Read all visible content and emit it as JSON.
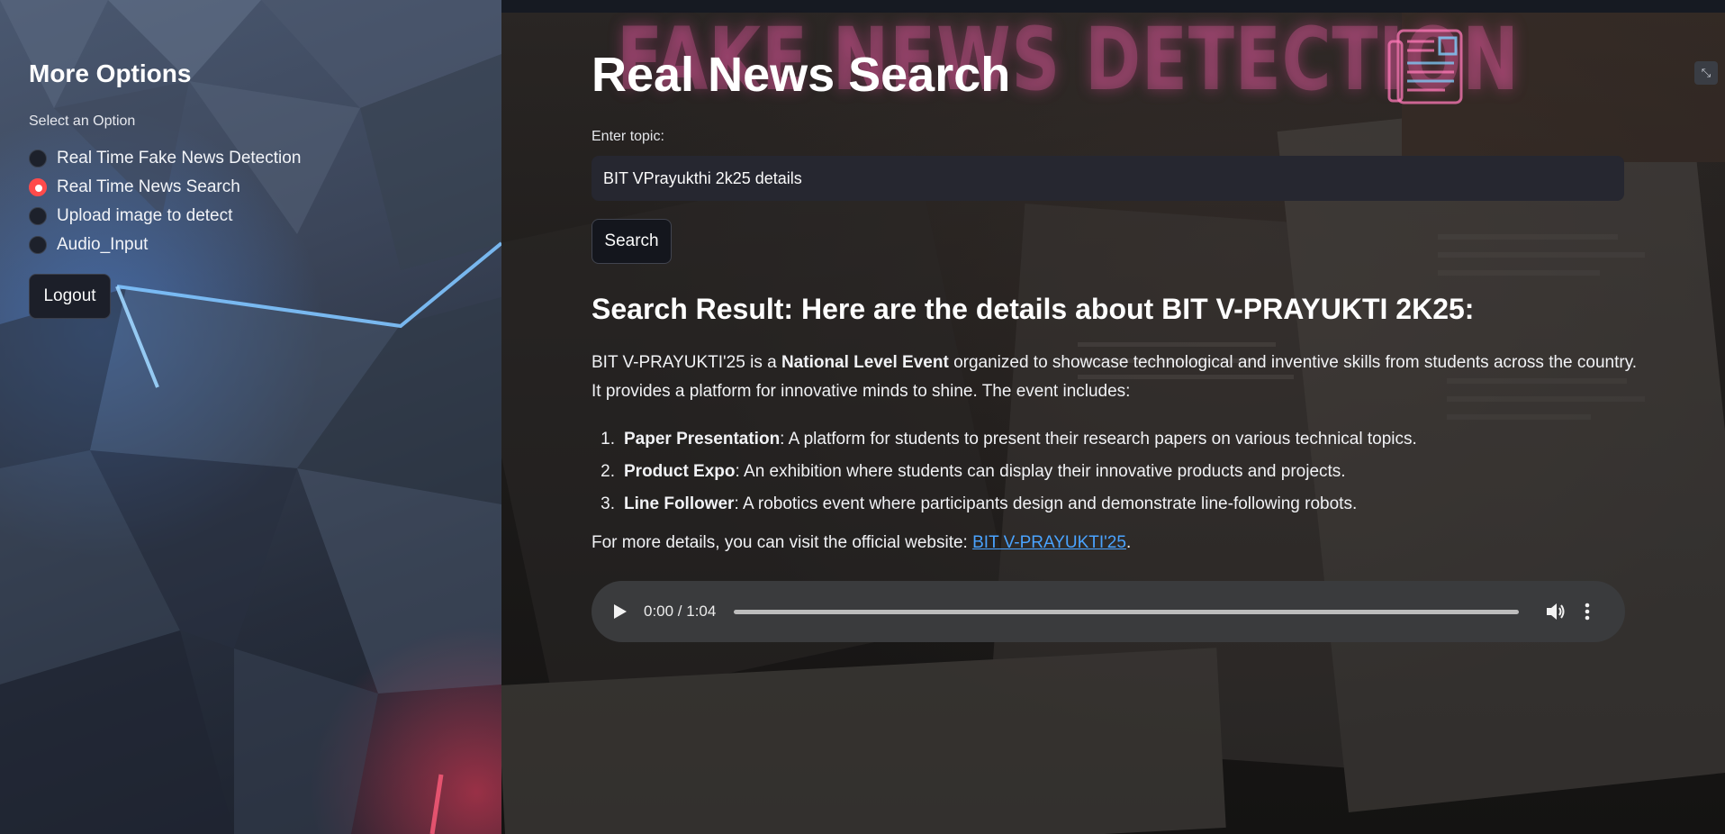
{
  "sidebar": {
    "title": "More Options",
    "select_label": "Select an Option",
    "options": [
      {
        "label": "Real Time Fake News Detection",
        "selected": false
      },
      {
        "label": "Real Time News Search",
        "selected": true
      },
      {
        "label": "Upload image to detect",
        "selected": false
      },
      {
        "label": "Audio_Input",
        "selected": false
      }
    ],
    "logout_label": "Logout",
    "accent_color": "#ff4b4b"
  },
  "banner": {
    "text": "FAKE NEWS DETECTION",
    "icon": "newspaper-icon"
  },
  "main": {
    "title": "Real News Search",
    "topic_label": "Enter topic:",
    "topic_value": "BIT VPrayukthi 2k25 details",
    "search_label": "Search",
    "result": {
      "heading": "Search Result: Here are the details about BIT V-PRAYUKTI 2K25:",
      "intro_start": "BIT V-PRAYUKTI'25 is a ",
      "intro_bold": "National Level Event",
      "intro_end": " organized to showcase technological and inventive skills from students across the country. It provides a platform for innovative minds to shine. The event includes:",
      "items": [
        {
          "num": "1.",
          "title": "Paper Presentation",
          "desc": ": A platform for students to present their research papers on various technical topics."
        },
        {
          "num": "2.",
          "title": "Product Expo",
          "desc": ": An exhibition where students can display their innovative products and projects."
        },
        {
          "num": "3.",
          "title": "Line Follower",
          "desc": ": A robotics event where participants design and demonstrate line-following robots."
        }
      ],
      "footer_text": "For more details, you can visit the official website: ",
      "footer_link": "BIT V-PRAYUKTI'25",
      "footer_end": ".",
      "link_color": "#4aa3ff"
    },
    "audio": {
      "time": "0:00 / 1:04",
      "progress": 0
    }
  }
}
